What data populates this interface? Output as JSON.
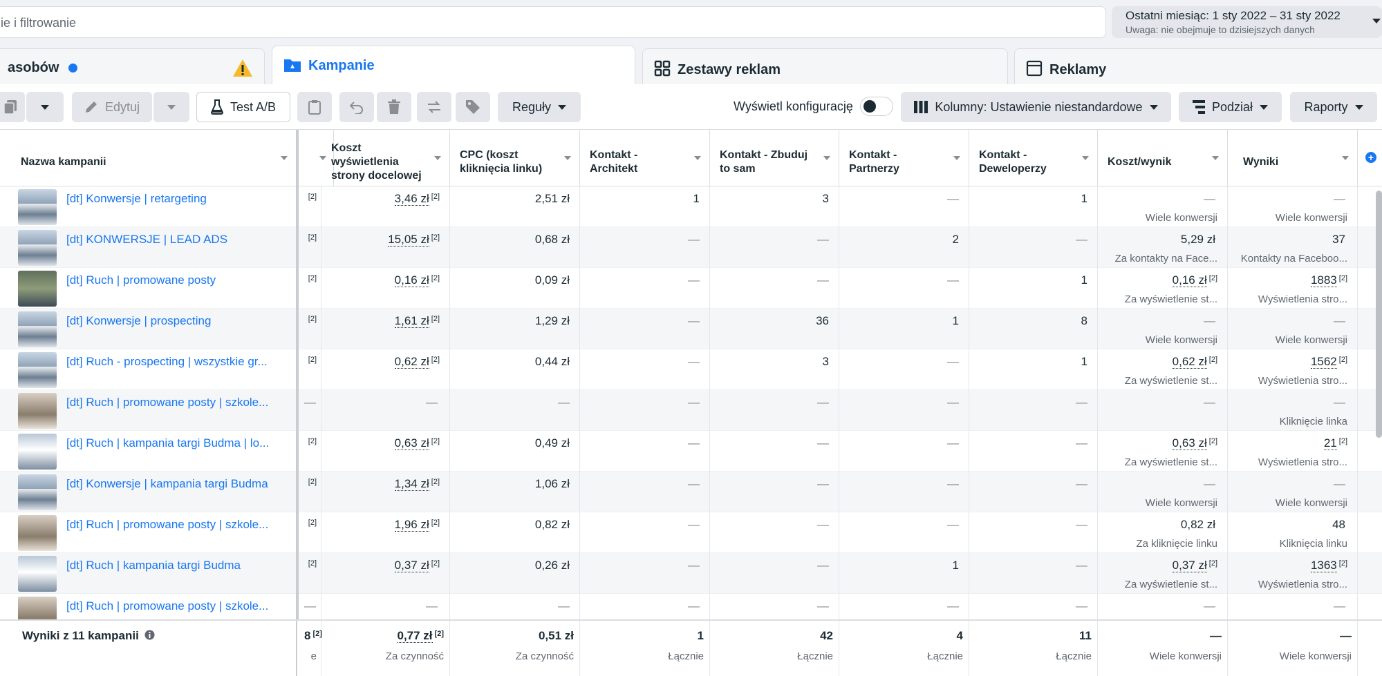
{
  "search": {
    "placeholder": "ie i filtrowanie"
  },
  "date_range": {
    "label": "Ostatni miesiąc: 1 sty 2022 – 31 sty 2022",
    "note": "Uwaga: nie obejmuje to dzisiejszych danych"
  },
  "tabs": [
    {
      "label": "asobów"
    },
    {
      "label": "Kampanie"
    },
    {
      "label": "Zestawy reklam"
    },
    {
      "label": "Reklamy"
    }
  ],
  "toolbar": {
    "edit": "Edytuj",
    "ab_test": "Test A/B",
    "rules": "Reguły",
    "show_config": "Wyświetl konfigurację",
    "columns": "Kolumny: Ustawienie niestandardowe",
    "breakdown": "Podział",
    "reports": "Raporty"
  },
  "columns": [
    "Nazwa kampanii",
    "",
    "Koszt wyświetlenia strony docelowej",
    "CPC (koszt kliknięcia linku)",
    "Kontakt - Architekt",
    "Kontakt - Zbuduj to sam",
    "Kontakt - Partnerzy",
    "Kontakt - Deweloperzy",
    "Koszt/wynik",
    "Wyniki"
  ],
  "rows": [
    {
      "name": "[dt] Konwersje | retargeting",
      "c1": "",
      "c1sup": "[2]",
      "koszt": "3,46 zł",
      "kosztsup": "[2]",
      "cpc": "2,51 zł",
      "arch": "1",
      "zbuduj": "3",
      "partn": "—",
      "dew": "1",
      "kw": "—",
      "kwsup": "",
      "kwsub": "Wiele konwersji",
      "wyn": "—",
      "wynsup": "",
      "wynsub": "Wiele konwersji"
    },
    {
      "name": "[dt] KONWERSJE | LEAD ADS",
      "c1": "",
      "c1sup": "[2]",
      "koszt": "15,05 zł",
      "kosztsup": "[2]",
      "cpc": "0,68 zł",
      "arch": "—",
      "zbuduj": "—",
      "partn": "2",
      "dew": "—",
      "kw": "5,29 zł",
      "kwsup": "",
      "kwsub": "Za kontakty na Face...",
      "wyn": "37",
      "wynsup": "",
      "wynsub": "Kontakty na Faceboo..."
    },
    {
      "name": "[dt] Ruch | promowane posty",
      "c1": "",
      "c1sup": "[2]",
      "koszt": "0,16 zł",
      "kosztsup": "[2]",
      "cpc": "0,09 zł",
      "arch": "—",
      "zbuduj": "—",
      "partn": "—",
      "dew": "1",
      "kw": "0,16 zł",
      "kwsup": "[2]",
      "kwsub": "Za wyświetlenie st...",
      "wyn": "1883",
      "wynsup": "[2]",
      "wynsub": "Wyświetlenia stro..."
    },
    {
      "name": "[dt] Konwersje | prospecting",
      "c1": "",
      "c1sup": "[2]",
      "koszt": "1,61 zł",
      "kosztsup": "[2]",
      "cpc": "1,29 zł",
      "arch": "—",
      "zbuduj": "36",
      "partn": "1",
      "dew": "8",
      "kw": "—",
      "kwsup": "",
      "kwsub": "Wiele konwersji",
      "wyn": "—",
      "wynsup": "",
      "wynsub": "Wiele konwersji"
    },
    {
      "name": "[dt] Ruch - prospecting | wszystkie gr...",
      "c1": "",
      "c1sup": "[2]",
      "koszt": "0,62 zł",
      "kosztsup": "[2]",
      "cpc": "0,44 zł",
      "arch": "—",
      "zbuduj": "3",
      "partn": "—",
      "dew": "1",
      "kw": "0,62 zł",
      "kwsup": "[2]",
      "kwsub": "Za wyświetlenie st...",
      "wyn": "1562",
      "wynsup": "[2]",
      "wynsub": "Wyświetlenia stro..."
    },
    {
      "name": "[dt] Ruch | promowane posty | szkole...",
      "c1": "—",
      "c1sup": "",
      "koszt": "—",
      "kosztsup": "",
      "cpc": "—",
      "arch": "—",
      "zbuduj": "—",
      "partn": "—",
      "dew": "—",
      "kw": "—",
      "kwsup": "",
      "kwsub": "",
      "wyn": "—",
      "wynsup": "",
      "wynsub": "Kliknięcie linka"
    },
    {
      "name": "[dt] Ruch | kampania targi Budma | lo...",
      "c1": "",
      "c1sup": "[2]",
      "koszt": "0,63 zł",
      "kosztsup": "[2]",
      "cpc": "0,49 zł",
      "arch": "—",
      "zbuduj": "—",
      "partn": "—",
      "dew": "—",
      "kw": "0,63 zł",
      "kwsup": "[2]",
      "kwsub": "Za wyświetlenie st...",
      "wyn": "21",
      "wynsup": "[2]",
      "wynsub": "Wyświetlenia stro..."
    },
    {
      "name": "[dt] Konwersje | kampania targi Budma",
      "c1": "",
      "c1sup": "[2]",
      "koszt": "1,34 zł",
      "kosztsup": "[2]",
      "cpc": "1,06 zł",
      "arch": "—",
      "zbuduj": "—",
      "partn": "—",
      "dew": "—",
      "kw": "—",
      "kwsup": "",
      "kwsub": "Wiele konwersji",
      "wyn": "—",
      "wynsup": "",
      "wynsub": "Wiele konwersji"
    },
    {
      "name": "[dt] Ruch | promowane posty | szkole...",
      "c1": "",
      "c1sup": "[2]",
      "koszt": "1,96 zł",
      "kosztsup": "[2]",
      "cpc": "0,82 zł",
      "arch": "—",
      "zbuduj": "—",
      "partn": "—",
      "dew": "—",
      "kw": "0,82 zł",
      "kwsup": "",
      "kwsub": "Za kliknięcie linku",
      "wyn": "48",
      "wynsup": "",
      "wynsub": "Kliknięcia linku"
    },
    {
      "name": "[dt] Ruch | kampania targi Budma",
      "c1": "",
      "c1sup": "[2]",
      "koszt": "0,37 zł",
      "kosztsup": "[2]",
      "cpc": "0,26 zł",
      "arch": "—",
      "zbuduj": "—",
      "partn": "1",
      "dew": "—",
      "kw": "0,37 zł",
      "kwsup": "[2]",
      "kwsub": "Za wyświetlenie st...",
      "wyn": "1363",
      "wynsup": "[2]",
      "wynsub": "Wyświetlenia stro..."
    },
    {
      "name": "[dt] Ruch | promowane posty | szkole...",
      "c1": "—",
      "c1sup": "",
      "koszt": "—",
      "kosztsup": "",
      "cpc": "—",
      "arch": "—",
      "zbuduj": "—",
      "partn": "—",
      "dew": "—",
      "kw": "—",
      "kwsup": "",
      "kwsub": "",
      "wyn": "—",
      "wynsup": "",
      "wynsub": ""
    }
  ],
  "footer": {
    "label": "Wyniki z 11 kampanii",
    "c1": "8",
    "c1sup": "[2]",
    "c1sub": "e",
    "koszt": "0,77 zł",
    "kosztsup": "[2]",
    "kosztsub": "Za czynność",
    "cpc": "0,51 zł",
    "cpcsub": "Za czynność",
    "arch": "1",
    "archsub": "Łącznie",
    "zbuduj": "42",
    "zbudujsub": "Łącznie",
    "partn": "4",
    "partnsub": "Łącznie",
    "dew": "11",
    "dewsub": "Łącznie",
    "kw": "—",
    "kwsub": "Wiele konwersji",
    "wyn": "—",
    "wynsub": "Wiele konwersji"
  },
  "colors": {
    "accent": "#1877f2",
    "warning": "#f7b928"
  }
}
